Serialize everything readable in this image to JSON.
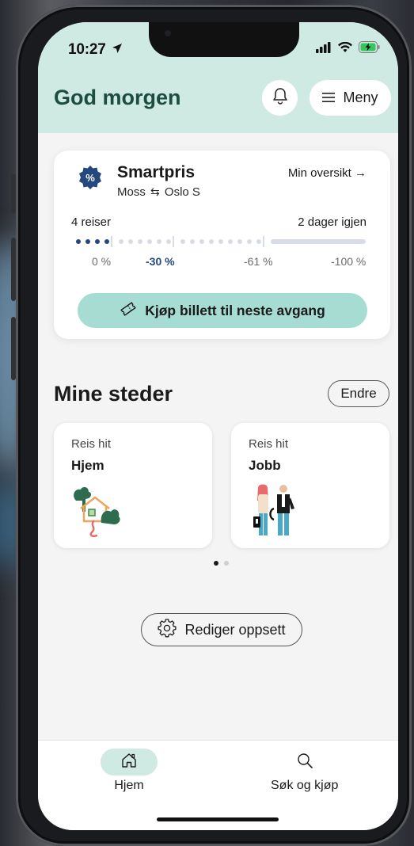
{
  "status_bar": {
    "time": "10:27"
  },
  "header": {
    "greeting": "God morgen",
    "menu_label": "Meny"
  },
  "smartpris": {
    "title": "Smartpris",
    "route_from": "Moss",
    "route_to": "Oslo S",
    "overview_link": "Min oversikt →",
    "trips": "4 reiser",
    "days_left": "2 dager igjen",
    "completed_trips": 4,
    "tiers": [
      "0 %",
      "-30 %",
      "-61 %",
      "-100 %"
    ],
    "active_tier": "-30 %",
    "buy_button": "Kjøp billett til neste avgang"
  },
  "places": {
    "title": "Mine steder",
    "edit_label": "Endre",
    "items": [
      {
        "kicker": "Reis hit",
        "name": "Hjem",
        "icon": "house-illustration"
      },
      {
        "kicker": "Reis hit",
        "name": "Jobb",
        "icon": "commuters-illustration"
      }
    ],
    "page_count": 2,
    "active_page": 1
  },
  "layout_button": "Rediger oppsett",
  "bottom_nav": {
    "items": [
      {
        "label": "Hjem",
        "icon": "home-icon",
        "active": true
      },
      {
        "label": "Søk og kjøp",
        "icon": "search-icon",
        "active": false
      }
    ]
  },
  "colors": {
    "header_bg": "#cfe9e3",
    "brand_green": "#1c4d40",
    "accent_teal": "#a7dcd3",
    "progress_blue": "#24487e"
  }
}
